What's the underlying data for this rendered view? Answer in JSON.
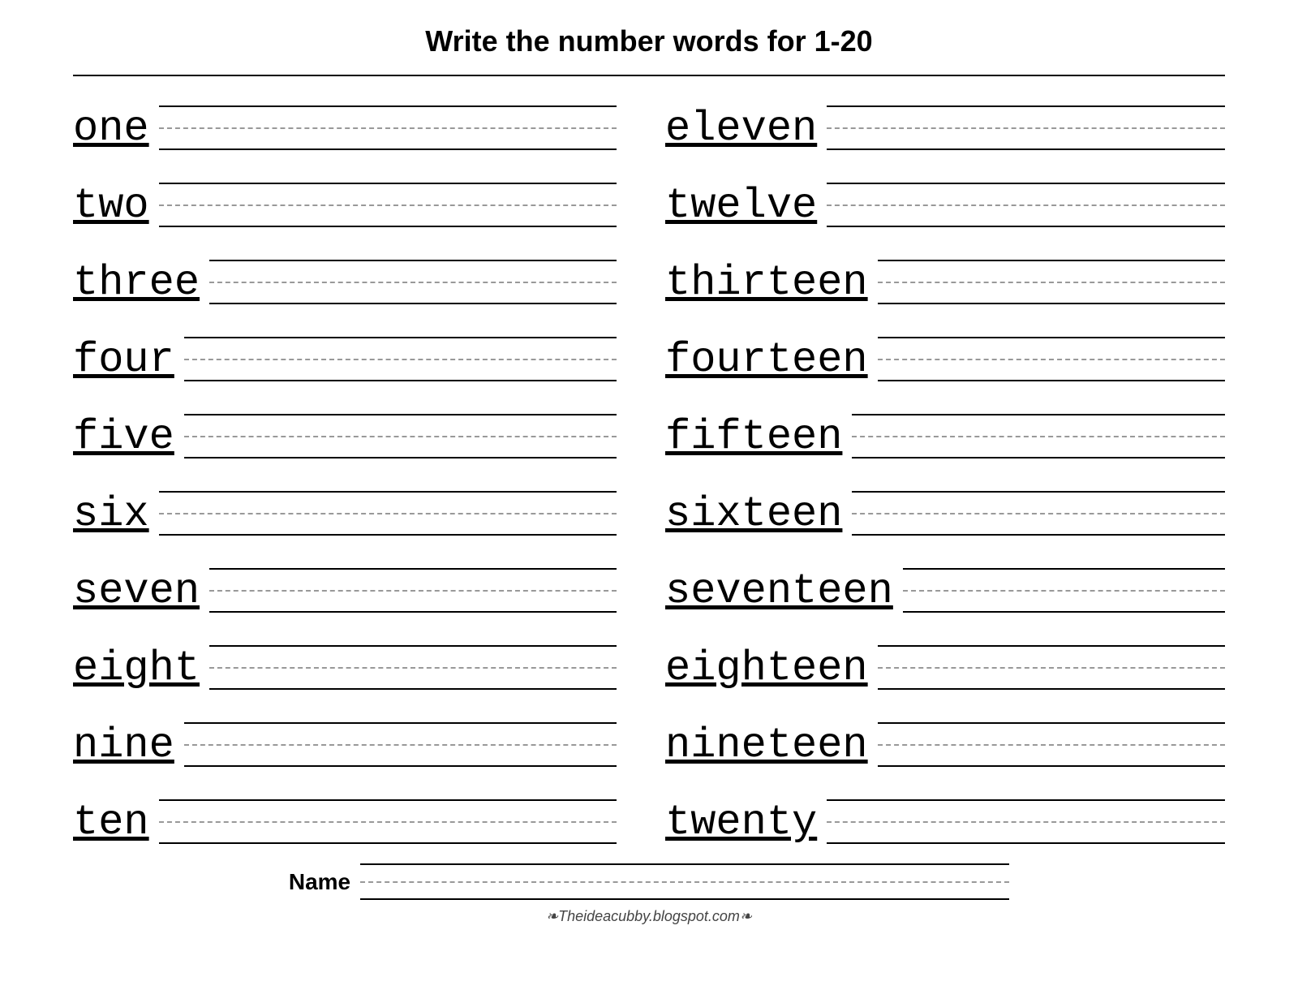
{
  "title": "Write the number words for  1-20",
  "left_words": [
    "one",
    "two",
    "three",
    "four",
    "five",
    "six",
    "seven",
    "eight",
    "nine",
    "ten"
  ],
  "right_words": [
    "eleven",
    "twelve",
    "thirteen",
    "fourteen",
    "fifteen",
    "sixteen",
    "seventeen",
    "eighteen",
    "nineteen",
    "twenty"
  ],
  "name_label": "Name",
  "footer": "❧Theideacubby.blogspot.com❧"
}
